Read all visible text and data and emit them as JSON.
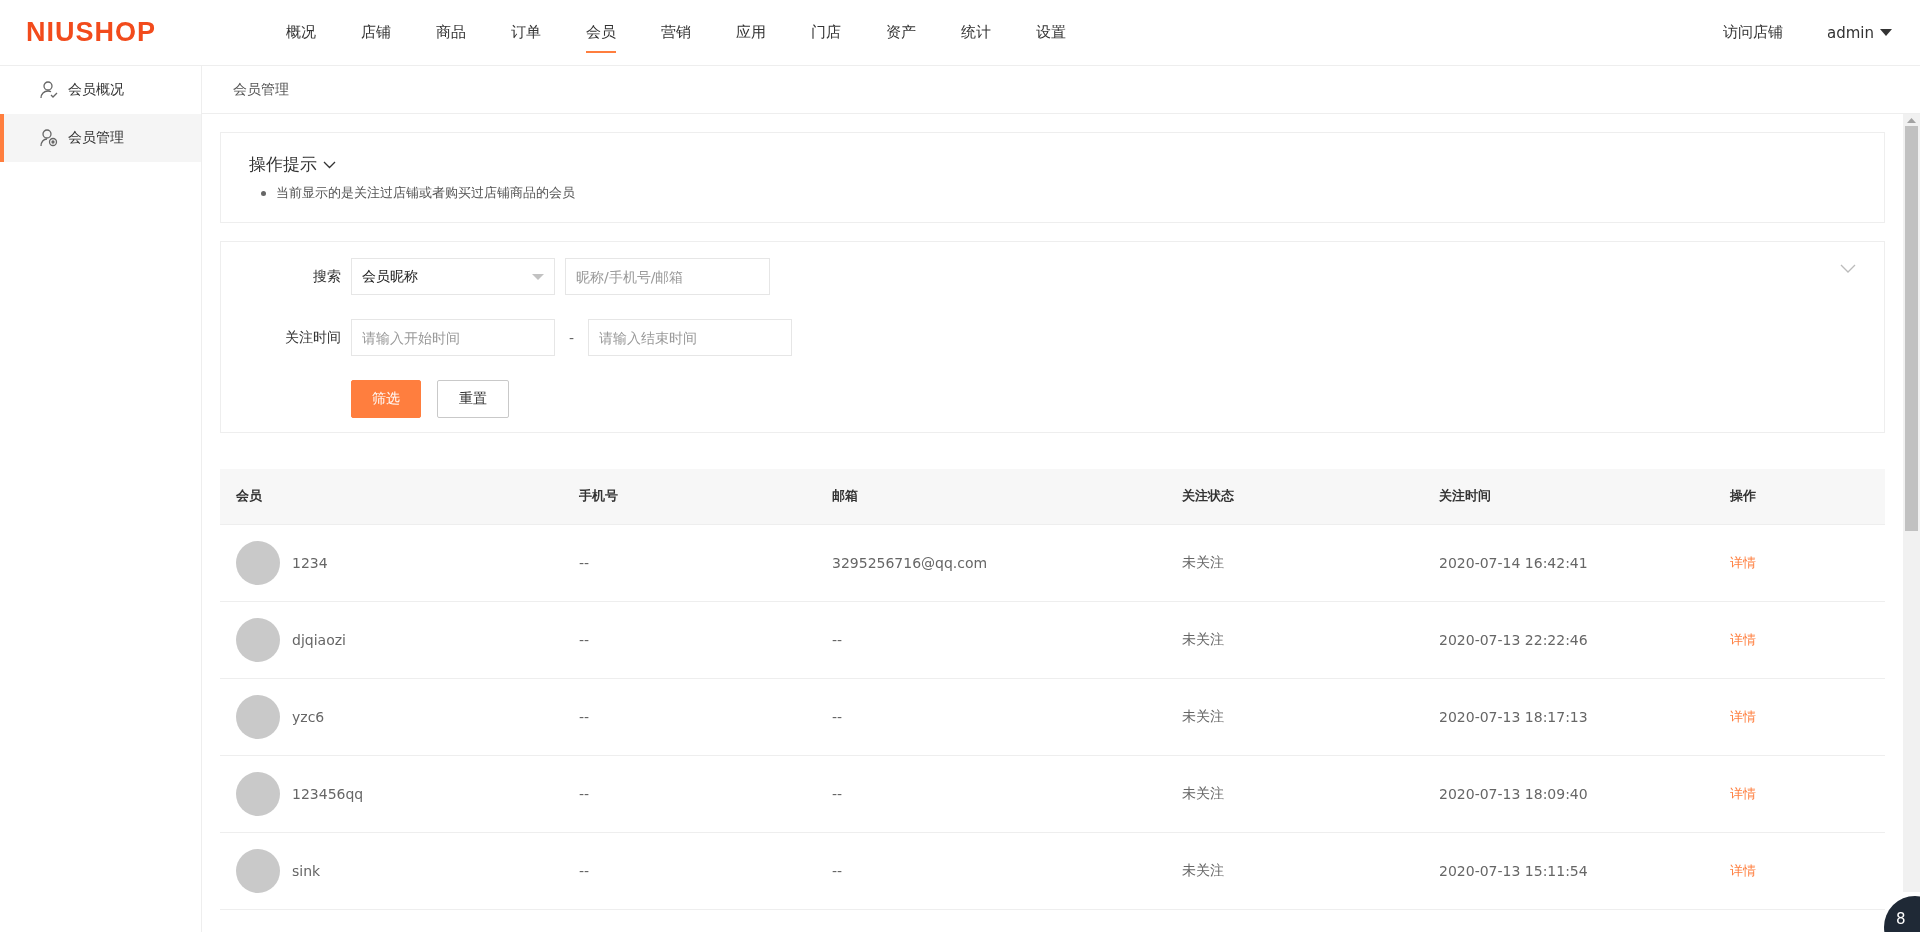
{
  "logo": "NIUSHOP",
  "nav": [
    {
      "label": "概况",
      "selected": false
    },
    {
      "label": "店铺",
      "selected": false
    },
    {
      "label": "商品",
      "selected": false
    },
    {
      "label": "订单",
      "selected": false
    },
    {
      "label": "会员",
      "selected": true
    },
    {
      "label": "营销",
      "selected": false
    },
    {
      "label": "应用",
      "selected": false
    },
    {
      "label": "门店",
      "selected": false
    },
    {
      "label": "资产",
      "selected": false
    },
    {
      "label": "统计",
      "selected": false
    },
    {
      "label": "设置",
      "selected": false
    }
  ],
  "header_links": {
    "visit_store": "访问店铺",
    "user": "admin"
  },
  "sidebar": {
    "items": [
      {
        "label": "会员概况",
        "kind": "overview",
        "selected": false
      },
      {
        "label": "会员管理",
        "kind": "manage",
        "selected": true
      }
    ]
  },
  "breadcrumb": "会员管理",
  "tips": {
    "title": "操作提示",
    "items": [
      "当前显示的是关注过店铺或者购买过店铺商品的会员"
    ]
  },
  "filter": {
    "search_label": "搜索",
    "search_type": "会员昵称",
    "search_placeholder": "昵称/手机号/邮箱",
    "time_label": "关注时间",
    "start_placeholder": "请输入开始时间",
    "separator": "-",
    "end_placeholder": "请输入结束时间",
    "buttons": [
      {
        "label": "筛选",
        "kind": "primary"
      },
      {
        "label": "重置",
        "kind": "default"
      }
    ]
  },
  "table": {
    "columns": [
      "会员",
      "手机号",
      "邮箱",
      "关注状态",
      "关注时间",
      "操作"
    ],
    "rows": [
      {
        "nickname": "1234",
        "phone": "--",
        "email": "3295256716@qq.com",
        "status": "未关注",
        "time": "2020-07-14 16:42:41",
        "action": "详情"
      },
      {
        "nickname": "djqiaozi",
        "phone": "--",
        "email": "--",
        "status": "未关注",
        "time": "2020-07-13 22:22:46",
        "action": "详情"
      },
      {
        "nickname": "yzc6",
        "phone": "--",
        "email": "--",
        "status": "未关注",
        "time": "2020-07-13 18:17:13",
        "action": "详情"
      },
      {
        "nickname": "123456qq",
        "phone": "--",
        "email": "--",
        "status": "未关注",
        "time": "2020-07-13 18:09:40",
        "action": "详情"
      },
      {
        "nickname": "sink",
        "phone": "--",
        "email": "--",
        "status": "未关注",
        "time": "2020-07-13 15:11:54",
        "action": "详情"
      }
    ]
  },
  "float_badge": "8"
}
